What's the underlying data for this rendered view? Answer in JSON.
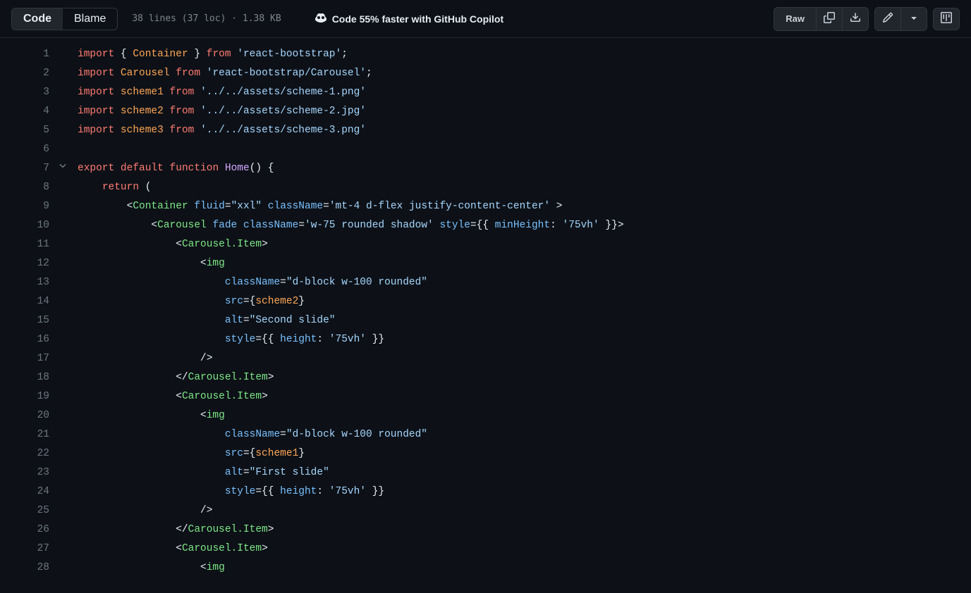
{
  "toolbar": {
    "code_tab": "Code",
    "blame_tab": "Blame",
    "file_info": "38 lines (37 loc) · 1.38 KB",
    "copilot_text": "Code 55% faster with GitHub Copilot",
    "raw_label": "Raw"
  },
  "code": {
    "lines": [
      {
        "n": 1,
        "t": [
          [
            "k-red",
            "import"
          ],
          [
            "k-gray",
            " { "
          ],
          [
            "k-orange",
            "Container"
          ],
          [
            "k-gray",
            " } "
          ],
          [
            "k-red",
            "from"
          ],
          [
            "k-gray",
            " "
          ],
          [
            "k-blue",
            "'react-bootstrap'"
          ],
          [
            "k-gray",
            ";"
          ]
        ]
      },
      {
        "n": 2,
        "t": [
          [
            "k-red",
            "import"
          ],
          [
            "k-gray",
            " "
          ],
          [
            "k-orange",
            "Carousel"
          ],
          [
            "k-gray",
            " "
          ],
          [
            "k-red",
            "from"
          ],
          [
            "k-gray",
            " "
          ],
          [
            "k-blue",
            "'react-bootstrap/Carousel'"
          ],
          [
            "k-gray",
            ";"
          ]
        ]
      },
      {
        "n": 3,
        "t": [
          [
            "k-red",
            "import"
          ],
          [
            "k-gray",
            " "
          ],
          [
            "k-orange",
            "scheme1"
          ],
          [
            "k-gray",
            " "
          ],
          [
            "k-red",
            "from"
          ],
          [
            "k-gray",
            " "
          ],
          [
            "k-blue",
            "'../../assets/scheme-1.png'"
          ]
        ]
      },
      {
        "n": 4,
        "t": [
          [
            "k-red",
            "import"
          ],
          [
            "k-gray",
            " "
          ],
          [
            "k-orange",
            "scheme2"
          ],
          [
            "k-gray",
            " "
          ],
          [
            "k-red",
            "from"
          ],
          [
            "k-gray",
            " "
          ],
          [
            "k-blue",
            "'../../assets/scheme-2.jpg'"
          ]
        ]
      },
      {
        "n": 5,
        "t": [
          [
            "k-red",
            "import"
          ],
          [
            "k-gray",
            " "
          ],
          [
            "k-orange",
            "scheme3"
          ],
          [
            "k-gray",
            " "
          ],
          [
            "k-red",
            "from"
          ],
          [
            "k-gray",
            " "
          ],
          [
            "k-blue",
            "'../../assets/scheme-3.png'"
          ]
        ]
      },
      {
        "n": 6,
        "t": [
          [
            "k-gray",
            ""
          ]
        ]
      },
      {
        "n": 7,
        "fold": true,
        "t": [
          [
            "k-red",
            "export"
          ],
          [
            "k-gray",
            " "
          ],
          [
            "k-red",
            "default"
          ],
          [
            "k-gray",
            " "
          ],
          [
            "k-red",
            "function"
          ],
          [
            "k-gray",
            " "
          ],
          [
            "k-purple",
            "Home"
          ],
          [
            "k-gray",
            "() {"
          ]
        ]
      },
      {
        "n": 8,
        "t": [
          [
            "k-gray",
            "    "
          ],
          [
            "k-red",
            "return"
          ],
          [
            "k-gray",
            " ("
          ]
        ]
      },
      {
        "n": 9,
        "t": [
          [
            "k-gray",
            "        <"
          ],
          [
            "k-green",
            "Container"
          ],
          [
            "k-gray",
            " "
          ],
          [
            "k-attr",
            "fluid"
          ],
          [
            "k-gray",
            "="
          ],
          [
            "k-blue",
            "\"xxl\""
          ],
          [
            "k-gray",
            " "
          ],
          [
            "k-attr",
            "className"
          ],
          [
            "k-gray",
            "="
          ],
          [
            "k-blue",
            "'mt-4 d-flex justify-content-center'"
          ],
          [
            "k-gray",
            " >"
          ]
        ]
      },
      {
        "n": 10,
        "t": [
          [
            "k-gray",
            "            <"
          ],
          [
            "k-green",
            "Carousel"
          ],
          [
            "k-gray",
            " "
          ],
          [
            "k-attr",
            "fade"
          ],
          [
            "k-gray",
            " "
          ],
          [
            "k-attr",
            "className"
          ],
          [
            "k-gray",
            "="
          ],
          [
            "k-blue",
            "'w-75 rounded shadow'"
          ],
          [
            "k-gray",
            " "
          ],
          [
            "k-attr",
            "style"
          ],
          [
            "k-gray",
            "={{ "
          ],
          [
            "k-attr",
            "minHeight"
          ],
          [
            "k-gray",
            ": "
          ],
          [
            "k-blue",
            "'75vh'"
          ],
          [
            "k-gray",
            " }}>"
          ]
        ]
      },
      {
        "n": 11,
        "t": [
          [
            "k-gray",
            "                <"
          ],
          [
            "k-green",
            "Carousel.Item"
          ],
          [
            "k-gray",
            ">"
          ]
        ]
      },
      {
        "n": 12,
        "t": [
          [
            "k-gray",
            "                    <"
          ],
          [
            "k-green",
            "img"
          ]
        ]
      },
      {
        "n": 13,
        "t": [
          [
            "k-gray",
            "                        "
          ],
          [
            "k-attr",
            "className"
          ],
          [
            "k-gray",
            "="
          ],
          [
            "k-blue",
            "\"d-block w-100 rounded\""
          ]
        ]
      },
      {
        "n": 14,
        "t": [
          [
            "k-gray",
            "                        "
          ],
          [
            "k-attr",
            "src"
          ],
          [
            "k-gray",
            "={"
          ],
          [
            "k-orange",
            "scheme2"
          ],
          [
            "k-gray",
            "}"
          ]
        ]
      },
      {
        "n": 15,
        "t": [
          [
            "k-gray",
            "                        "
          ],
          [
            "k-attr",
            "alt"
          ],
          [
            "k-gray",
            "="
          ],
          [
            "k-blue",
            "\"Second slide\""
          ]
        ]
      },
      {
        "n": 16,
        "t": [
          [
            "k-gray",
            "                        "
          ],
          [
            "k-attr",
            "style"
          ],
          [
            "k-gray",
            "={{ "
          ],
          [
            "k-attr",
            "height"
          ],
          [
            "k-gray",
            ": "
          ],
          [
            "k-blue",
            "'75vh'"
          ],
          [
            "k-gray",
            " }}"
          ]
        ]
      },
      {
        "n": 17,
        "t": [
          [
            "k-gray",
            "                    />"
          ]
        ]
      },
      {
        "n": 18,
        "t": [
          [
            "k-gray",
            "                </"
          ],
          [
            "k-green",
            "Carousel.Item"
          ],
          [
            "k-gray",
            ">"
          ]
        ]
      },
      {
        "n": 19,
        "t": [
          [
            "k-gray",
            "                <"
          ],
          [
            "k-green",
            "Carousel.Item"
          ],
          [
            "k-gray",
            ">"
          ]
        ]
      },
      {
        "n": 20,
        "t": [
          [
            "k-gray",
            "                    <"
          ],
          [
            "k-green",
            "img"
          ]
        ]
      },
      {
        "n": 21,
        "t": [
          [
            "k-gray",
            "                        "
          ],
          [
            "k-attr",
            "className"
          ],
          [
            "k-gray",
            "="
          ],
          [
            "k-blue",
            "\"d-block w-100 rounded\""
          ]
        ]
      },
      {
        "n": 22,
        "t": [
          [
            "k-gray",
            "                        "
          ],
          [
            "k-attr",
            "src"
          ],
          [
            "k-gray",
            "={"
          ],
          [
            "k-orange",
            "scheme1"
          ],
          [
            "k-gray",
            "}"
          ]
        ]
      },
      {
        "n": 23,
        "t": [
          [
            "k-gray",
            "                        "
          ],
          [
            "k-attr",
            "alt"
          ],
          [
            "k-gray",
            "="
          ],
          [
            "k-blue",
            "\"First slide\""
          ]
        ]
      },
      {
        "n": 24,
        "t": [
          [
            "k-gray",
            "                        "
          ],
          [
            "k-attr",
            "style"
          ],
          [
            "k-gray",
            "={{ "
          ],
          [
            "k-attr",
            "height"
          ],
          [
            "k-gray",
            ": "
          ],
          [
            "k-blue",
            "'75vh'"
          ],
          [
            "k-gray",
            " }}"
          ]
        ]
      },
      {
        "n": 25,
        "t": [
          [
            "k-gray",
            "                    />"
          ]
        ]
      },
      {
        "n": 26,
        "t": [
          [
            "k-gray",
            "                </"
          ],
          [
            "k-green",
            "Carousel.Item"
          ],
          [
            "k-gray",
            ">"
          ]
        ]
      },
      {
        "n": 27,
        "t": [
          [
            "k-gray",
            "                <"
          ],
          [
            "k-green",
            "Carousel.Item"
          ],
          [
            "k-gray",
            ">"
          ]
        ]
      },
      {
        "n": 28,
        "t": [
          [
            "k-gray",
            "                    <"
          ],
          [
            "k-green",
            "img"
          ]
        ]
      }
    ]
  }
}
